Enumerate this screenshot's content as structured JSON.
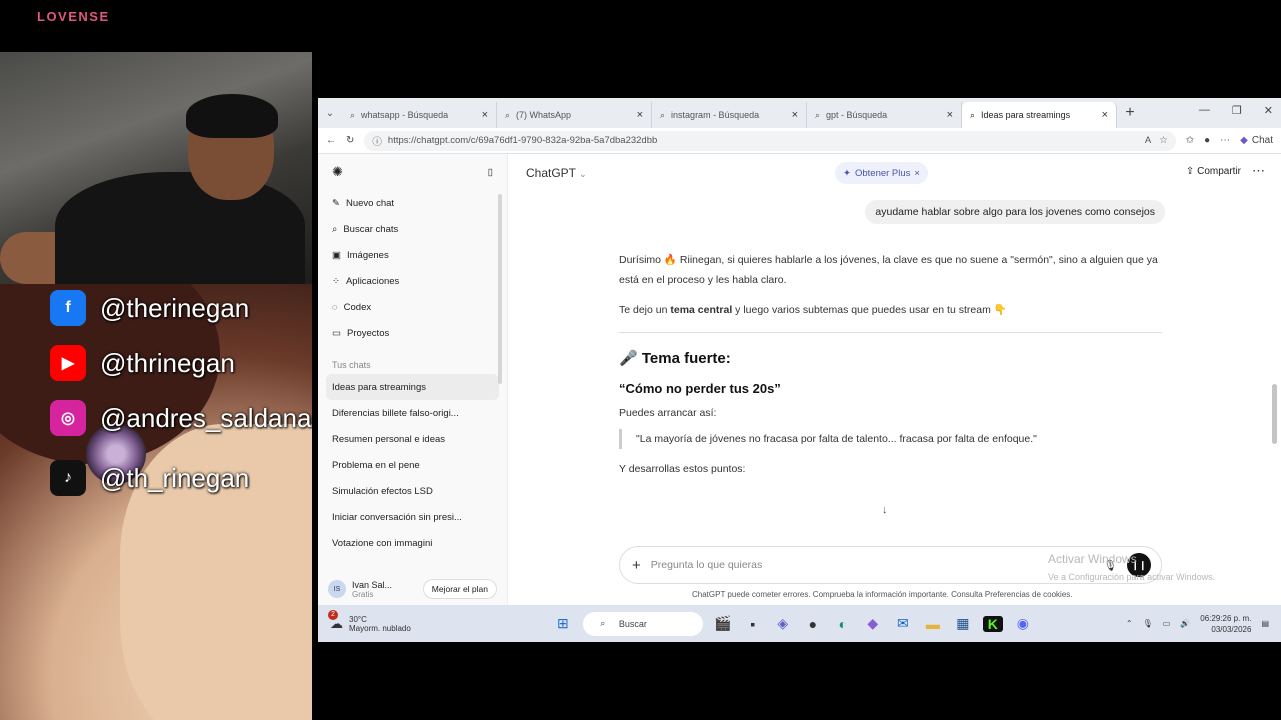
{
  "overlay": {
    "brand": "LOVENSE",
    "socials": [
      {
        "icon": "facebook-icon",
        "glyph": "f",
        "color": "#1877f2",
        "handle": "@therinegan"
      },
      {
        "icon": "youtube-icon",
        "glyph": "▶",
        "color": "#ff0000",
        "handle": "@thrinegan"
      },
      {
        "icon": "instagram-icon",
        "glyph": "◎",
        "color": "#d6249f",
        "handle": "@andres_saldana"
      },
      {
        "icon": "tiktok-icon",
        "glyph": "♪",
        "color": "#111111",
        "handle": "@th_rinegan"
      }
    ]
  },
  "browser": {
    "tabs": [
      {
        "label": "whatsapp - Búsqueda",
        "active": false
      },
      {
        "label": "(7) WhatsApp",
        "active": false
      },
      {
        "label": "instagram - Búsqueda",
        "active": false
      },
      {
        "label": "gpt - Búsqueda",
        "active": false
      },
      {
        "label": "Ideas para streamings",
        "active": true
      }
    ],
    "url": "https://chatgpt.com/c/69a76df1-9790-832a-92ba-5a7dba232dbb",
    "chat_button": "Chat"
  },
  "sidebar": {
    "items": [
      {
        "icon": "edit-icon",
        "glyph": "✎",
        "label": "Nuevo chat"
      },
      {
        "icon": "search-icon",
        "glyph": "⌕",
        "label": "Buscar chats"
      },
      {
        "icon": "image-icon",
        "glyph": "▣",
        "label": "Imágenes"
      },
      {
        "icon": "apps-icon",
        "glyph": "⁘",
        "label": "Aplicaciones"
      },
      {
        "icon": "codex-icon",
        "glyph": "◌",
        "label": "Codex"
      },
      {
        "icon": "folder-icon",
        "glyph": "▭",
        "label": "Proyectos"
      }
    ],
    "section": "Tus chats",
    "chats": [
      "Ideas para streamings",
      "Diferencias billete falso-origi...",
      "Resumen personal e ideas",
      "Problema en el pene",
      "Simulación efectos LSD",
      "Iniciar conversación sin presi...",
      "Votazione con immagini"
    ],
    "user": {
      "initials": "IS",
      "name": "Ivan Sal...",
      "plan": "Gratis",
      "upgrade": "Mejorar el plan"
    }
  },
  "main": {
    "model": "ChatGPT",
    "get_plus": "Obtener Plus",
    "share": "Compartir",
    "user_message": "ayudame hablar sobre algo para los jovenes como consejos",
    "p1": "Durísimo 🔥 Riinegan, si quieres hablarle a los jóvenes, la clave es que no suene a \"sermón\", sino a alguien que ya está en el proceso y les habla claro.",
    "p2_pre": "Te dejo un ",
    "p2_bold": "tema central",
    "p2_post": " y luego varios subtemas que puedes usar en tu stream 👇",
    "heading": "🎤 Tema fuerte:",
    "subheading": "“Cómo no perder tus 20s”",
    "p3": "Puedes arrancar así:",
    "quote": "\"La mayoría de jóvenes no fracasa por falta de talento... fracasa por falta de enfoque.\"",
    "p4": "Y desarrollas estos puntos:",
    "composer_placeholder": "Pregunta lo que quieras",
    "watermark1": "Activar Windows",
    "watermark2": "Ve a Configuración para activar Windows.",
    "disclaimer": "ChatGPT puede cometer errores. Comprueba la información importante. Consulta Preferencias de cookies."
  },
  "taskbar": {
    "weather_temp": "30°C",
    "weather_desc": "Mayorm. nublado",
    "weather_badge": "2",
    "search": "Buscar",
    "time": "06:29:26 p. m.",
    "date": "03/03/2026"
  }
}
